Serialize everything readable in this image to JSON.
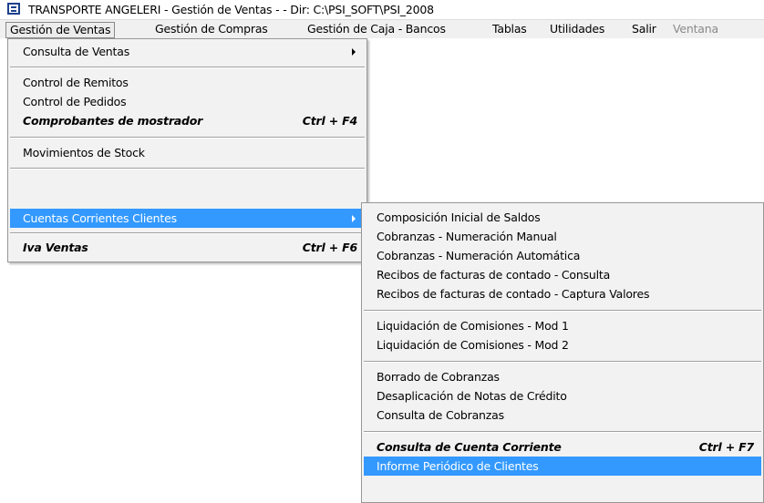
{
  "window": {
    "title": "TRANSPORTE ANGELERI - Gestión de Ventas -  - Dir: C:\\PSI_SOFT\\PSI_2008"
  },
  "menubar": {
    "items": [
      {
        "label": "Gestión de Ventas"
      },
      {
        "label": "Gestión de Compras"
      },
      {
        "label": "Gestión de Caja - Bancos"
      },
      {
        "label": "Tablas"
      },
      {
        "label": "Utilidades"
      },
      {
        "label": "Salir"
      },
      {
        "label": "Ventana"
      }
    ]
  },
  "ventas_menu": {
    "items": [
      {
        "label": "Consulta de Ventas"
      },
      {
        "label": "Control de Remitos"
      },
      {
        "label": "Control de Pedidos"
      },
      {
        "label": "Comprobantes de mostrador",
        "shortcut": "Ctrl + F4"
      },
      {
        "label": "Movimientos de Stock"
      },
      {
        "label": "Cuentas Corrientes Clientes"
      },
      {
        "label": "Iva Ventas",
        "shortcut": "Ctrl + F6"
      }
    ]
  },
  "ctacte_submenu": {
    "items": [
      {
        "label": "Composición Inicial de Saldos"
      },
      {
        "label": "Cobranzas - Numeración Manual"
      },
      {
        "label": "Cobranzas - Numeración Automática"
      },
      {
        "label": "Recibos de facturas de contado - Consulta"
      },
      {
        "label": "Recibos de facturas de contado - Captura Valores"
      },
      {
        "label": "Liquidación de Comisiones - Mod 1"
      },
      {
        "label": "Liquidación de Comisiones - Mod 2"
      },
      {
        "label": "Borrado de Cobranzas"
      },
      {
        "label": "Desaplicación de Notas de Crédito"
      },
      {
        "label": "Consulta de Cobranzas"
      },
      {
        "label": "Consulta de Cuenta Corriente",
        "shortcut": "Ctrl + F7"
      },
      {
        "label": "Informe Periódico de Clientes"
      }
    ]
  },
  "colors": {
    "highlight": "#3399ff",
    "menu_bg": "#f2f2f2",
    "disabled_text": "#8a8a8a"
  }
}
